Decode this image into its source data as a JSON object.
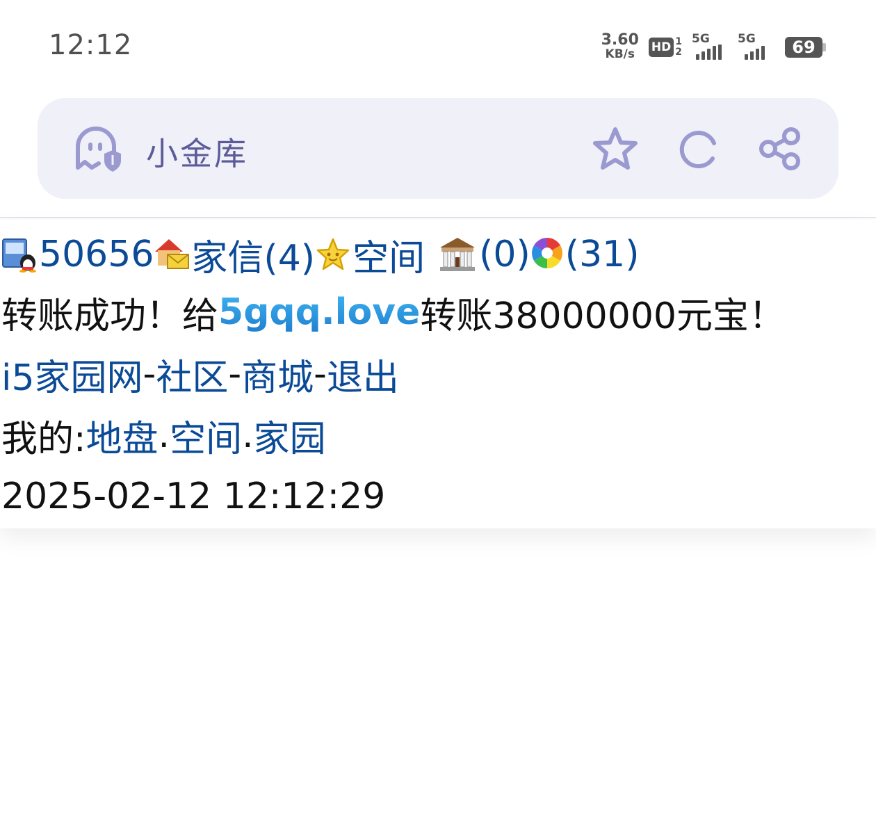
{
  "status_bar": {
    "time": "12:12",
    "net_speed_value": "3.60",
    "net_speed_unit": "KB/s",
    "hd_label": "HD",
    "hd_sub_top": "1",
    "hd_sub_bottom": "2",
    "sim1_label": "5G",
    "sim2_label": "5G",
    "battery": "69",
    "icons": [
      "hd-volte-icon",
      "signal-5g-icon",
      "signal-5g-icon",
      "battery-icon"
    ]
  },
  "titlebar": {
    "title": "小金库",
    "icons": [
      "ghost-shield-icon",
      "star-icon",
      "refresh-icon",
      "share-icon"
    ]
  },
  "userbar": {
    "user_id": "50656",
    "mail_label": "家信(4)",
    "space_label": "空间",
    "bank_count": "(0)",
    "photo_count": "(31)",
    "icons": [
      "qq-user-icon",
      "mail-house-icon",
      "star-badge-icon",
      "bank-icon",
      "pinwheel-icon"
    ]
  },
  "message": {
    "prefix": "转账成功！给",
    "recipient": "5gqq.love",
    "suffix": "转账38000000元宝！"
  },
  "nav": {
    "home": "i5家园网",
    "sep": "-",
    "community": "社区",
    "mall": "商城",
    "logout": "退出"
  },
  "mine": {
    "label": "我的:",
    "land": "地盘",
    "dot": ".",
    "space": "空间",
    "home": "家园"
  },
  "timestamp": "2025-02-12 12:12:29",
  "colors": {
    "link": "#0a4a96",
    "titlebar_bg": "#f0f0f8",
    "titlebar_icon": "#9a9ad0",
    "recipient_gradient": [
      "#3fb4f0",
      "#1f7fd0"
    ]
  }
}
